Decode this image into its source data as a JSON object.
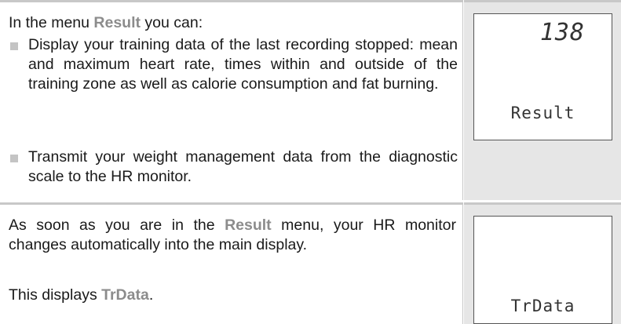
{
  "row1": {
    "intro_prefix": "In the menu ",
    "intro_highlight": "Result",
    "intro_suffix": " you can:",
    "bullets": [
      "Display your training data of the last recording stopped: mean and maximum heart rate, times within and outside of the training zone as well as calorie consumption and fat burning.",
      "Transmit your weight management data from the diagnostic scale to the HR monitor."
    ],
    "display": {
      "number": "138",
      "label": "Result"
    }
  },
  "row2": {
    "para1_prefix": "As soon as you are in the ",
    "para1_highlight": "Result",
    "para1_suffix": " menu, your HR monitor changes automatically into the main display.",
    "para2_prefix": "This displays ",
    "para2_highlight": "TrData",
    "para2_suffix": ".",
    "display": {
      "label": "TrData"
    }
  }
}
